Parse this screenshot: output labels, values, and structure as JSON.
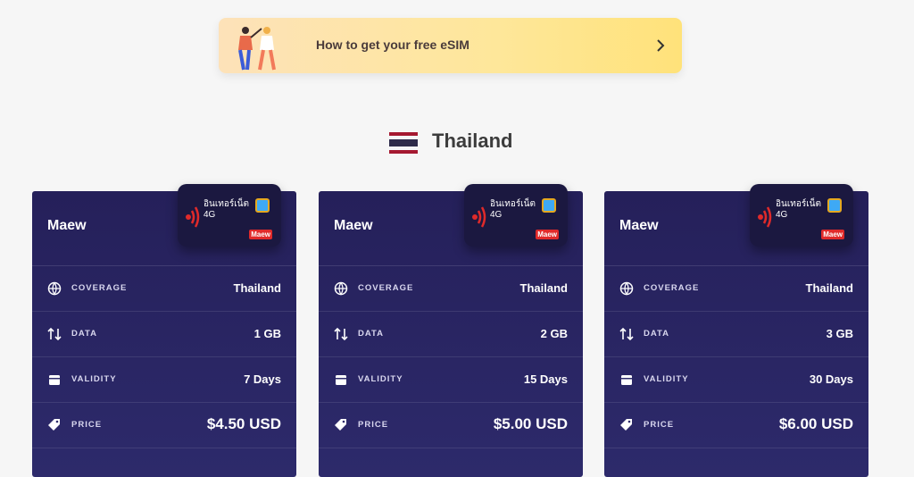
{
  "banner": {
    "text": "How to get your free eSIM"
  },
  "country": {
    "name": "Thailand"
  },
  "sim": {
    "line1": "อินเทอร์เน็ต",
    "line2": "4G",
    "logo": "Maew"
  },
  "row_labels": {
    "coverage": "COVERAGE",
    "data": "DATA",
    "validity": "VALIDITY",
    "price": "PRICE"
  },
  "plans": [
    {
      "operator": "Maew",
      "coverage": "Thailand",
      "data": "1 GB",
      "validity": "7 Days",
      "price": "$4.50 USD"
    },
    {
      "operator": "Maew",
      "coverage": "Thailand",
      "data": "2 GB",
      "validity": "15 Days",
      "price": "$5.00 USD"
    },
    {
      "operator": "Maew",
      "coverage": "Thailand",
      "data": "3 GB",
      "validity": "30 Days",
      "price": "$6.00 USD"
    }
  ],
  "colors": {
    "card_bg": "#25205a",
    "banner_bg": "#fee79a",
    "sim_red": "#e02a2a"
  }
}
